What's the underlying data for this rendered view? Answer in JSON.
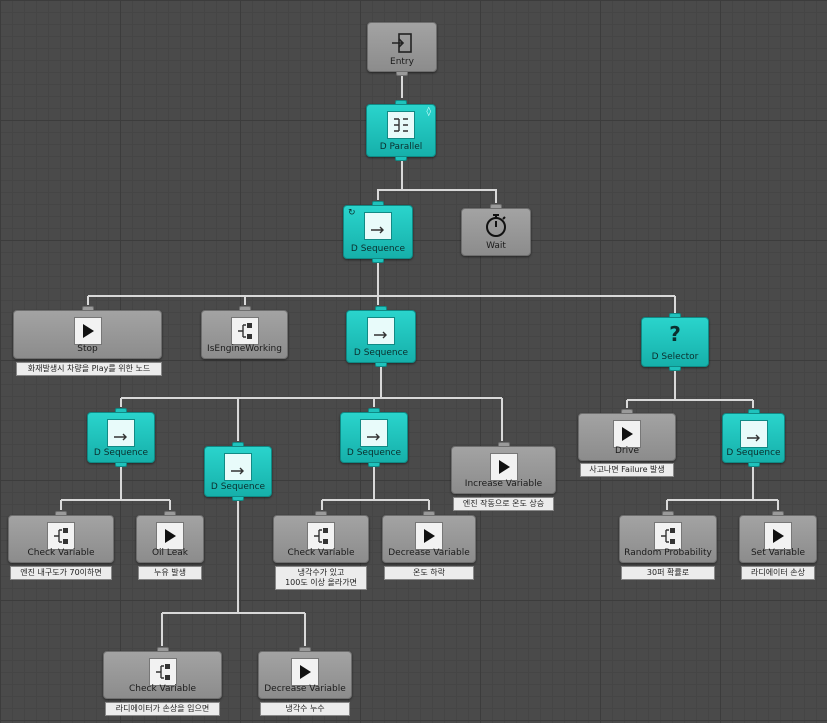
{
  "nodes": {
    "entry": {
      "label": "Entry",
      "icon": "entry-icon"
    },
    "parallel": {
      "label": "D Parallel",
      "icon": "parallel-icon"
    },
    "seq_root": {
      "label": "D Sequence",
      "icon": "sequence-icon"
    },
    "wait": {
      "label": "Wait",
      "icon": "stopwatch-icon"
    },
    "stop": {
      "label": "Stop",
      "icon": "play-icon"
    },
    "is_engine": {
      "label": "IsEngineWorking",
      "icon": "conditional-icon"
    },
    "seq_mid": {
      "label": "D Sequence",
      "icon": "sequence-icon"
    },
    "selector": {
      "label": "D Selector",
      "icon": "question-icon"
    },
    "seq_a": {
      "label": "D Sequence",
      "icon": "sequence-icon"
    },
    "seq_b": {
      "label": "D Sequence",
      "icon": "sequence-icon"
    },
    "seq_c": {
      "label": "D Sequence",
      "icon": "sequence-icon"
    },
    "inc_var": {
      "label": "Increase Variable",
      "icon": "play-icon"
    },
    "drive": {
      "label": "Drive",
      "icon": "play-icon"
    },
    "seq_d": {
      "label": "D Sequence",
      "icon": "sequence-icon"
    },
    "check_a": {
      "label": "Check Variable",
      "icon": "conditional-icon"
    },
    "oil_leak": {
      "label": "Oil Leak",
      "icon": "play-icon"
    },
    "check_c": {
      "label": "Check Variable",
      "icon": "conditional-icon"
    },
    "dec_c": {
      "label": "Decrease Variable",
      "icon": "play-icon"
    },
    "rand_prob": {
      "label": "Random Probability",
      "icon": "conditional-icon"
    },
    "set_var": {
      "label": "Set Variable",
      "icon": "play-icon"
    },
    "check_b": {
      "label": "Check Variable",
      "icon": "conditional-icon"
    },
    "dec_b": {
      "label": "Decrease Variable",
      "icon": "play-icon"
    }
  },
  "comments": {
    "stop": "화재발생시 차량을 Play를 위한 노드",
    "inc_var": "엔진 작동으로 온도 상승",
    "drive": "사고나면 Failure 발생",
    "check_a": "엔진 내구도가 70이하면",
    "oil_leak": "누유 발생",
    "check_c_1": "냉각수가 있고",
    "check_c_2": "100도 이상 올라가면",
    "dec_c": "온도 하락",
    "rand_prob": "30퍼 확률로",
    "set_var": "라디에이터 손상",
    "check_b": "라디에이터가 손상을 입으면",
    "dec_b": "냉각수 누수"
  },
  "colors": {
    "composite": "#1fc2bc",
    "task": "#999999",
    "wire": "#d9d9d9"
  }
}
